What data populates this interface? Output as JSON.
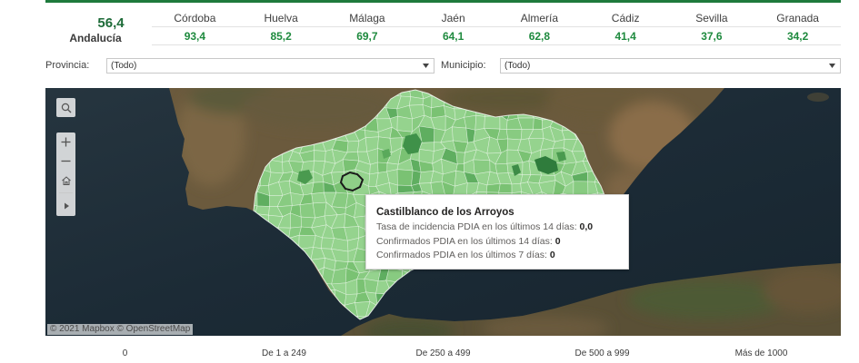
{
  "colors": {
    "accent": "#1e7a3c",
    "value_green": "#1e8a3e",
    "region_fill": "#8fcf88",
    "selected_outline": "#1a1a1a"
  },
  "summary": {
    "value": "56,4",
    "label": "Andalucía"
  },
  "provinces": [
    {
      "name": "Córdoba",
      "value": "93,4"
    },
    {
      "name": "Huelva",
      "value": "85,2"
    },
    {
      "name": "Málaga",
      "value": "69,7"
    },
    {
      "name": "Jaén",
      "value": "64,1"
    },
    {
      "name": "Almería",
      "value": "62,8"
    },
    {
      "name": "Cádiz",
      "value": "41,4"
    },
    {
      "name": "Sevilla",
      "value": "37,6"
    },
    {
      "name": "Granada",
      "value": "34,2"
    }
  ],
  "filters": {
    "provincia": {
      "label": "Provincia:",
      "value": "(Todo)",
      "icon": "chevron-down-icon"
    },
    "municipio": {
      "label": "Municipio:",
      "value": "(Todo)",
      "icon": "chevron-down-icon"
    }
  },
  "map": {
    "controls": [
      "search-icon",
      "zoom-in-icon",
      "zoom-out-icon",
      "home-icon",
      "play-icon"
    ],
    "attribution": "© 2021 Mapbox © OpenStreetMap"
  },
  "tooltip": {
    "title": "Castilblanco de los Arroyos",
    "rows": [
      {
        "label": "Tasa de incidencia PDIA en los últimos 14 días:",
        "value": "0,0"
      },
      {
        "label": "Confirmados PDIA en los últimos 14 días:",
        "value": "0"
      },
      {
        "label": "Confirmados PDIA en los últimos 7 días:",
        "value": "0"
      }
    ]
  },
  "legend": [
    "0",
    "De 1 a 249",
    "De 250 a 499",
    "De 500 a 999",
    "Más de 1000"
  ]
}
